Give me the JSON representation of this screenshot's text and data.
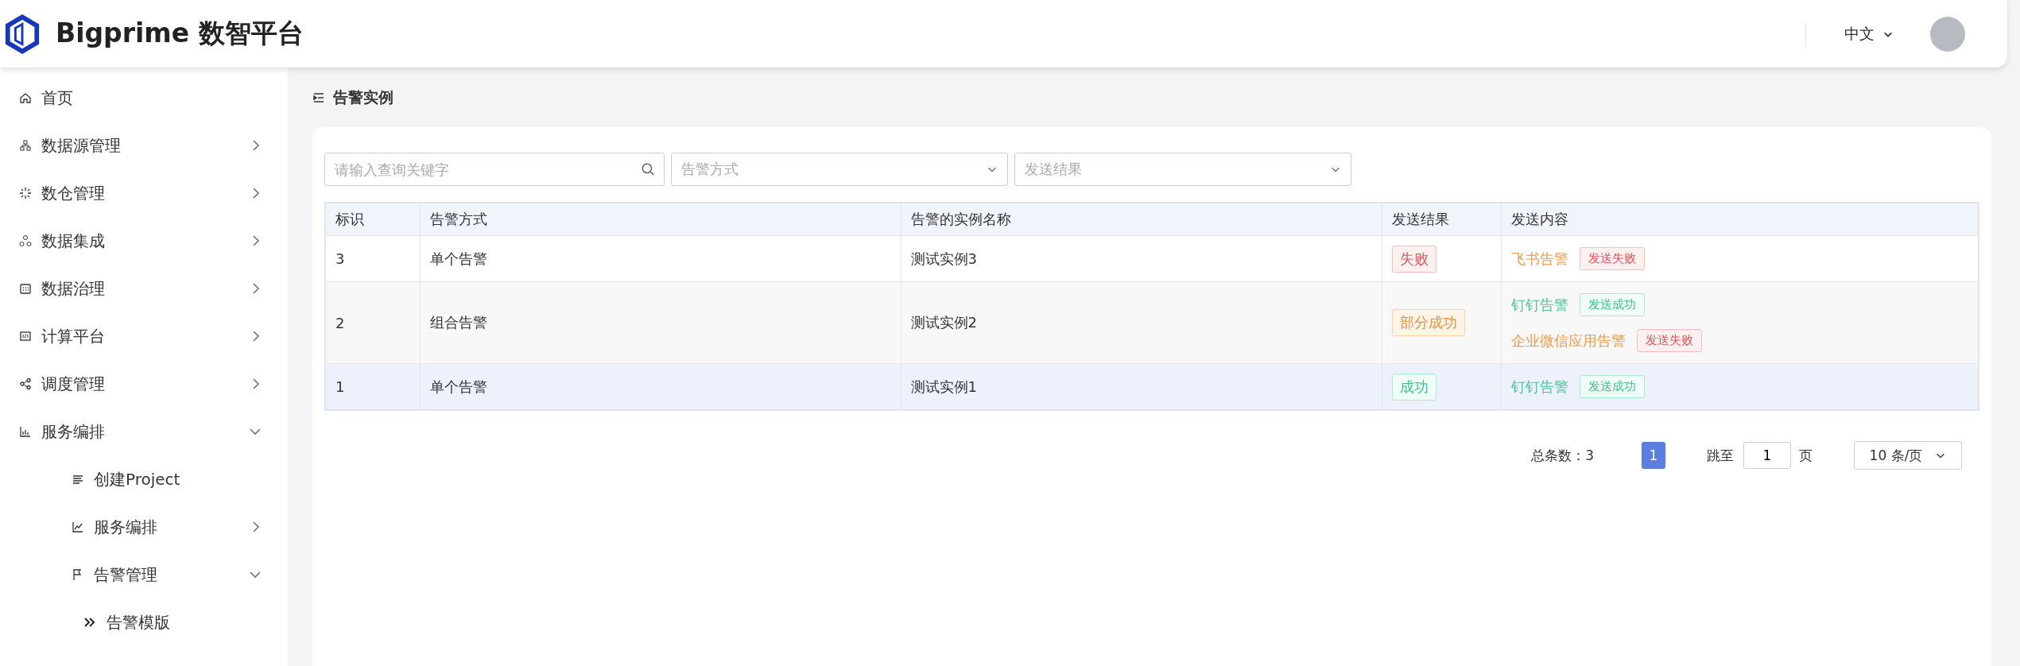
{
  "header": {
    "brand": "Bigprime 数智平台",
    "language": "中文"
  },
  "sidebar": {
    "items": [
      {
        "label": "首页"
      },
      {
        "label": "数据源管理",
        "expanded": false
      },
      {
        "label": "数仓管理",
        "expanded": false
      },
      {
        "label": "数据集成",
        "expanded": false
      },
      {
        "label": "数据治理",
        "expanded": false
      },
      {
        "label": "计算平台",
        "expanded": false
      },
      {
        "label": "调度管理",
        "expanded": false
      },
      {
        "label": "服务编排",
        "expanded": true,
        "children": [
          {
            "label": "创建Project"
          },
          {
            "label": "服务编排",
            "expanded": false
          },
          {
            "label": "告警管理",
            "expanded": true,
            "children": [
              {
                "label": "告警模版"
              }
            ]
          }
        ]
      }
    ]
  },
  "page": {
    "title": "告警实例"
  },
  "filters": {
    "search": {
      "placeholder": "请输入查询关键字"
    },
    "method": {
      "placeholder": "告警方式"
    },
    "result": {
      "placeholder": "发送结果"
    }
  },
  "table": {
    "columns": [
      "标识",
      "告警方式",
      "告警的实例名称",
      "发送结果",
      "发送内容"
    ],
    "rows": [
      {
        "id": "3",
        "method": "单个告警",
        "name": "测试实例3",
        "result": {
          "text": "失败",
          "kind": "error"
        },
        "selected": false,
        "contents": [
          {
            "channel": "飞书告警",
            "status": "发送失败",
            "kind": "error"
          }
        ]
      },
      {
        "id": "2",
        "method": "组合告警",
        "name": "测试实例2",
        "result": {
          "text": "部分成功",
          "kind": "warning"
        },
        "selected": false,
        "contents": [
          {
            "channel": "钉钉告警",
            "status": "发送成功",
            "kind": "success"
          },
          {
            "channel": "企业微信应用告警",
            "status": "发送失败",
            "kind": "error"
          }
        ]
      },
      {
        "id": "1",
        "method": "单个告警",
        "name": "测试实例1",
        "result": {
          "text": "成功",
          "kind": "success"
        },
        "selected": true,
        "contents": [
          {
            "channel": "钉钉告警",
            "status": "发送成功",
            "kind": "success"
          }
        ]
      }
    ]
  },
  "pagination": {
    "total": "总条数：3",
    "pages": [
      {
        "label": "1",
        "selected": true
      }
    ],
    "jump_label": "跳至",
    "jump_value": "1",
    "page_unit": "页",
    "page_size": "10 条/页"
  }
}
